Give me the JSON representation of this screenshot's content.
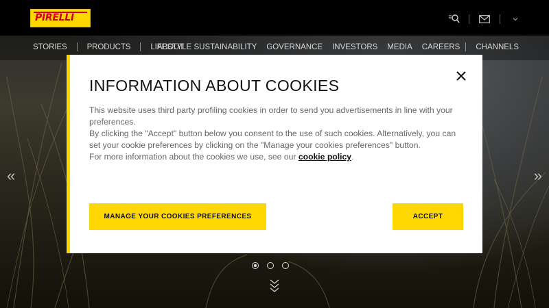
{
  "header": {
    "logo_text": "PIRELLI",
    "icons": [
      "search-icon",
      "mail-icon",
      "chevron-down-icon"
    ]
  },
  "nav": {
    "left": [
      "STORIES",
      "PRODUCTS",
      "LIFESTYLE"
    ],
    "right": [
      "ABOUT",
      "SUSTAINABILITY",
      "GOVERNANCE",
      "INVESTORS",
      "MEDIA",
      "CAREERS",
      "CHANNELS"
    ]
  },
  "carousel": {
    "prev_glyph": "«",
    "next_glyph": "»",
    "slides": 3,
    "active_slide": 1
  },
  "cookie_modal": {
    "title": "INFORMATION ABOUT COOKIES",
    "paragraph_1": "This website uses third party profiling cookies in order to send you advertisements in line with your preferences.",
    "paragraph_2": "By clicking the \"Accept\" button below you consent to the use of such cookies. Alternatively, you can set your cookie preferences by clicking on the \"Manage your cookies preferences\" button.",
    "paragraph_3_prefix": "For more information about the cookies we use, see our ",
    "link_text": "cookie policy",
    "paragraph_3_suffix": ".",
    "manage_button": "MANAGE YOUR COOKIES PREFERENCES",
    "accept_button": "ACCEPT"
  },
  "colors": {
    "brand_yellow": "#fed700",
    "brand_red": "#d0021b"
  }
}
